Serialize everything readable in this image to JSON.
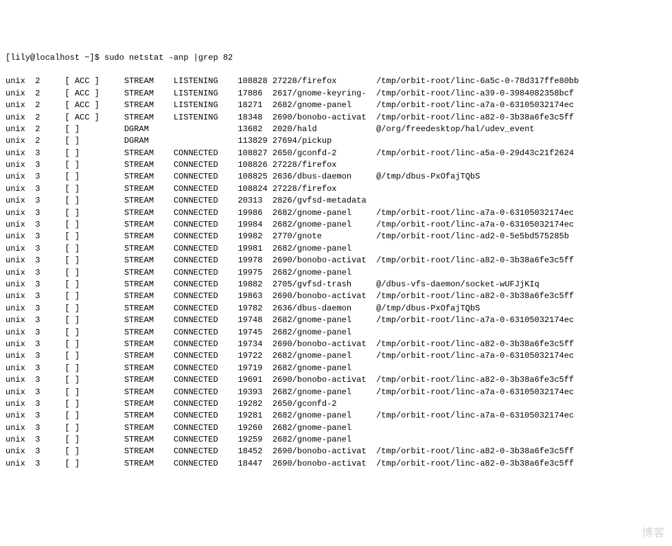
{
  "prompt": {
    "user_host": "[lily@localhost ~]$ ",
    "command": "sudo netstat -anp |grep 82"
  },
  "rows": [
    {
      "proto": "unix",
      "refcnt": "2",
      "flags": "[ ACC ]",
      "type": "STREAM",
      "state": "LISTENING",
      "inode": "108828",
      "pid": "27228/firefox",
      "path": "/tmp/orbit-root/linc-6a5c-0-78d317ffe80bb"
    },
    {
      "proto": "unix",
      "refcnt": "2",
      "flags": "[ ACC ]",
      "type": "STREAM",
      "state": "LISTENING",
      "inode": "17886",
      "pid": "2617/gnome-keyring-",
      "path": "/tmp/orbit-root/linc-a39-0-3984082358bcf"
    },
    {
      "proto": "unix",
      "refcnt": "2",
      "flags": "[ ACC ]",
      "type": "STREAM",
      "state": "LISTENING",
      "inode": "18271",
      "pid": "2682/gnome-panel",
      "path": "/tmp/orbit-root/linc-a7a-0-63105032174ec"
    },
    {
      "proto": "unix",
      "refcnt": "2",
      "flags": "[ ACC ]",
      "type": "STREAM",
      "state": "LISTENING",
      "inode": "18348",
      "pid": "2690/bonobo-activat",
      "path": "/tmp/orbit-root/linc-a82-0-3b38a6fe3c5ff"
    },
    {
      "proto": "unix",
      "refcnt": "2",
      "flags": "[ ]",
      "type": "DGRAM",
      "state": "",
      "inode": "13682",
      "pid": "2020/hald",
      "path": "@/org/freedesktop/hal/udev_event"
    },
    {
      "proto": "unix",
      "refcnt": "2",
      "flags": "[ ]",
      "type": "DGRAM",
      "state": "",
      "inode": "113829",
      "pid": "27694/pickup",
      "path": ""
    },
    {
      "proto": "unix",
      "refcnt": "3",
      "flags": "[ ]",
      "type": "STREAM",
      "state": "CONNECTED",
      "inode": "108827",
      "pid": "2650/gconfd-2",
      "path": "/tmp/orbit-root/linc-a5a-0-29d43c21f2624"
    },
    {
      "proto": "unix",
      "refcnt": "3",
      "flags": "[ ]",
      "type": "STREAM",
      "state": "CONNECTED",
      "inode": "108826",
      "pid": "27228/firefox",
      "path": ""
    },
    {
      "proto": "unix",
      "refcnt": "3",
      "flags": "[ ]",
      "type": "STREAM",
      "state": "CONNECTED",
      "inode": "108825",
      "pid": "2636/dbus-daemon",
      "path": "@/tmp/dbus-PxOfajTQbS"
    },
    {
      "proto": "unix",
      "refcnt": "3",
      "flags": "[ ]",
      "type": "STREAM",
      "state": "CONNECTED",
      "inode": "108824",
      "pid": "27228/firefox",
      "path": ""
    },
    {
      "proto": "unix",
      "refcnt": "3",
      "flags": "[ ]",
      "type": "STREAM",
      "state": "CONNECTED",
      "inode": "20313",
      "pid": "2826/gvfsd-metadata",
      "path": ""
    },
    {
      "proto": "unix",
      "refcnt": "3",
      "flags": "[ ]",
      "type": "STREAM",
      "state": "CONNECTED",
      "inode": "19986",
      "pid": "2682/gnome-panel",
      "path": "/tmp/orbit-root/linc-a7a-0-63105032174ec"
    },
    {
      "proto": "unix",
      "refcnt": "3",
      "flags": "[ ]",
      "type": "STREAM",
      "state": "CONNECTED",
      "inode": "19984",
      "pid": "2682/gnome-panel",
      "path": "/tmp/orbit-root/linc-a7a-0-63105032174ec"
    },
    {
      "proto": "unix",
      "refcnt": "3",
      "flags": "[ ]",
      "type": "STREAM",
      "state": "CONNECTED",
      "inode": "19982",
      "pid": "2770/gnote",
      "path": "/tmp/orbit-root/linc-ad2-0-5e5bd575285b"
    },
    {
      "proto": "unix",
      "refcnt": "3",
      "flags": "[ ]",
      "type": "STREAM",
      "state": "CONNECTED",
      "inode": "19981",
      "pid": "2682/gnome-panel",
      "path": ""
    },
    {
      "proto": "unix",
      "refcnt": "3",
      "flags": "[ ]",
      "type": "STREAM",
      "state": "CONNECTED",
      "inode": "19978",
      "pid": "2690/bonobo-activat",
      "path": "/tmp/orbit-root/linc-a82-0-3b38a6fe3c5ff"
    },
    {
      "proto": "unix",
      "refcnt": "3",
      "flags": "[ ]",
      "type": "STREAM",
      "state": "CONNECTED",
      "inode": "19975",
      "pid": "2682/gnome-panel",
      "path": ""
    },
    {
      "proto": "unix",
      "refcnt": "3",
      "flags": "[ ]",
      "type": "STREAM",
      "state": "CONNECTED",
      "inode": "19882",
      "pid": "2705/gvfsd-trash",
      "path": "@/dbus-vfs-daemon/socket-wUFJjKIq"
    },
    {
      "proto": "unix",
      "refcnt": "3",
      "flags": "[ ]",
      "type": "STREAM",
      "state": "CONNECTED",
      "inode": "19863",
      "pid": "2690/bonobo-activat",
      "path": "/tmp/orbit-root/linc-a82-0-3b38a6fe3c5ff"
    },
    {
      "proto": "unix",
      "refcnt": "3",
      "flags": "[ ]",
      "type": "STREAM",
      "state": "CONNECTED",
      "inode": "19782",
      "pid": "2636/dbus-daemon",
      "path": "@/tmp/dbus-PxOfajTQbS"
    },
    {
      "proto": "unix",
      "refcnt": "3",
      "flags": "[ ]",
      "type": "STREAM",
      "state": "CONNECTED",
      "inode": "19748",
      "pid": "2682/gnome-panel",
      "path": "/tmp/orbit-root/linc-a7a-0-63105032174ec"
    },
    {
      "proto": "unix",
      "refcnt": "3",
      "flags": "[ ]",
      "type": "STREAM",
      "state": "CONNECTED",
      "inode": "19745",
      "pid": "2682/gnome-panel",
      "path": ""
    },
    {
      "proto": "unix",
      "refcnt": "3",
      "flags": "[ ]",
      "type": "STREAM",
      "state": "CONNECTED",
      "inode": "19734",
      "pid": "2690/bonobo-activat",
      "path": "/tmp/orbit-root/linc-a82-0-3b38a6fe3c5ff"
    },
    {
      "proto": "unix",
      "refcnt": "3",
      "flags": "[ ]",
      "type": "STREAM",
      "state": "CONNECTED",
      "inode": "19722",
      "pid": "2682/gnome-panel",
      "path": "/tmp/orbit-root/linc-a7a-0-63105032174ec"
    },
    {
      "proto": "unix",
      "refcnt": "3",
      "flags": "[ ]",
      "type": "STREAM",
      "state": "CONNECTED",
      "inode": "19719",
      "pid": "2682/gnome-panel",
      "path": ""
    },
    {
      "proto": "unix",
      "refcnt": "3",
      "flags": "[ ]",
      "type": "STREAM",
      "state": "CONNECTED",
      "inode": "19691",
      "pid": "2690/bonobo-activat",
      "path": "/tmp/orbit-root/linc-a82-0-3b38a6fe3c5ff"
    },
    {
      "proto": "unix",
      "refcnt": "3",
      "flags": "[ ]",
      "type": "STREAM",
      "state": "CONNECTED",
      "inode": "19393",
      "pid": "2682/gnome-panel",
      "path": "/tmp/orbit-root/linc-a7a-0-63105032174ec"
    },
    {
      "proto": "unix",
      "refcnt": "3",
      "flags": "[ ]",
      "type": "STREAM",
      "state": "CONNECTED",
      "inode": "19282",
      "pid": "2650/gconfd-2",
      "path": ""
    },
    {
      "proto": "unix",
      "refcnt": "3",
      "flags": "[ ]",
      "type": "STREAM",
      "state": "CONNECTED",
      "inode": "19281",
      "pid": "2682/gnome-panel",
      "path": "/tmp/orbit-root/linc-a7a-0-63105032174ec"
    },
    {
      "proto": "unix",
      "refcnt": "3",
      "flags": "[ ]",
      "type": "STREAM",
      "state": "CONNECTED",
      "inode": "19260",
      "pid": "2682/gnome-panel",
      "path": ""
    },
    {
      "proto": "unix",
      "refcnt": "3",
      "flags": "[ ]",
      "type": "STREAM",
      "state": "CONNECTED",
      "inode": "19259",
      "pid": "2682/gnome-panel",
      "path": ""
    },
    {
      "proto": "unix",
      "refcnt": "3",
      "flags": "[ ]",
      "type": "STREAM",
      "state": "CONNECTED",
      "inode": "18452",
      "pid": "2690/bonobo-activat",
      "path": "/tmp/orbit-root/linc-a82-0-3b38a6fe3c5ff"
    },
    {
      "proto": "unix",
      "refcnt": "3",
      "flags": "[ ]",
      "type": "STREAM",
      "state": "CONNECTED",
      "inode": "18447",
      "pid": "2690/bonobo-activat",
      "path": "/tmp/orbit-root/linc-a82-0-3b38a6fe3c5ff"
    }
  ],
  "watermark": "博客"
}
